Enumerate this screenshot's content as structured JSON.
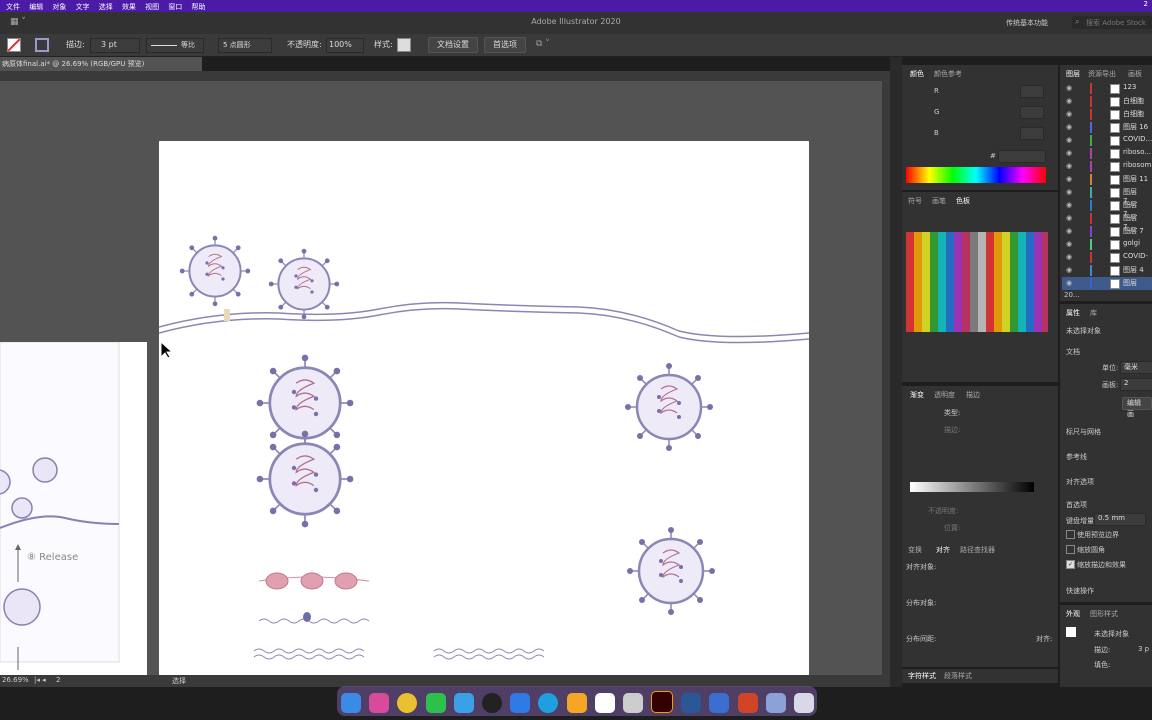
{
  "menubar": {
    "items": [
      "文件",
      "编辑",
      "对象",
      "文字",
      "选择",
      "效果",
      "视图",
      "窗口",
      "帮助"
    ],
    "right": "2"
  },
  "titlebar": {
    "title": "Adobe Illustrator 2020",
    "workspace": "传统基本功能",
    "search_placeholder": "搜索 Adobe Stock"
  },
  "options": {
    "stroke_label": "描边:",
    "stroke_value": "3 pt",
    "line_label": "等比",
    "brush_label": "5 点圆形",
    "opacity_label": "不透明度:",
    "opacity_value": "100%",
    "style_label": "样式:",
    "doc_setup": "文档设置",
    "prefs": "首选项"
  },
  "document": {
    "tab_title": "病原体final.ai* @ 26.69% (RGB/GPU 预览)"
  },
  "status": {
    "zoom": "26.69%",
    "page": "2",
    "tool": "选择"
  },
  "artboard2": {
    "release_label": "⑧ Release"
  },
  "color_panel": {
    "tabs": [
      "颜色",
      "颜色参考"
    ],
    "channels": [
      "R",
      "G",
      "B"
    ],
    "hex_label": "#"
  },
  "swatches_panel": {
    "tabs": [
      "符号",
      "画笔",
      "色板"
    ]
  },
  "gradient_panel": {
    "tabs": [
      "渐变",
      "透明度",
      "描边"
    ],
    "type_label": "类型:",
    "stroke_label": "描边:",
    "opacity_label": "不透明度:",
    "position_label": "位置:"
  },
  "align_panel": {
    "tabs": [
      "变换",
      "对齐",
      "路径查找器"
    ],
    "align_objects": "对齐对象:",
    "distribute_objects": "分布对象:",
    "distribute_spacing": "分布间距:",
    "align_to": "对齐:"
  },
  "char_panel": {
    "tabs": [
      "字符样式",
      "段落样式"
    ]
  },
  "layers_panel": {
    "tabs": [
      "图层",
      "资源导出",
      "画板"
    ],
    "count": "20...",
    "layers": [
      {
        "name": "123",
        "color": "#cc3333"
      },
      {
        "name": "白细胞",
        "color": "#cc3333"
      },
      {
        "name": "白细胞",
        "color": "#cc3333"
      },
      {
        "name": "图层 16",
        "color": "#5566dd"
      },
      {
        "name": "COVID...",
        "color": "#44aa44"
      },
      {
        "name": "riboso...",
        "color": "#aa44aa"
      },
      {
        "name": "ribosom",
        "color": "#aa44aa"
      },
      {
        "name": "图层 11",
        "color": "#cc8833"
      },
      {
        "name": "图层 7_...",
        "color": "#44aaaa"
      },
      {
        "name": "图层 7_...",
        "color": "#3377cc"
      },
      {
        "name": "图层 7_...",
        "color": "#cc3333"
      },
      {
        "name": "图层 7",
        "color": "#8844cc"
      },
      {
        "name": "golgi",
        "color": "#44cc88"
      },
      {
        "name": "COVID-",
        "color": "#cc3333"
      },
      {
        "name": "图层 4",
        "color": "#4488cc"
      },
      {
        "name": "图层",
        "color": "#3366cc"
      }
    ]
  },
  "properties_panel": {
    "tabs": [
      "属性",
      "库"
    ],
    "no_selection": "未选择对象",
    "document_label": "文档",
    "units_label": "单位:",
    "units_value": "毫米",
    "artboard_label": "画板:",
    "artboard_value": "2",
    "edit_artboards": "编辑画",
    "rulers_label": "标尺与网格",
    "guides_label": "参考线",
    "align_label": "对齐选项",
    "prefs_label": "首选项",
    "keyboard_label": "键盘增量:",
    "keyboard_value": "0.5 mm",
    "preview_bounds": "使用预览边界",
    "scale_corners": "缩放圆角",
    "scale_strokes": "缩放描边和效果",
    "quick_actions": "快速操作"
  },
  "appearance_panel": {
    "tabs": [
      "外观",
      "图形样式"
    ],
    "no_selection": "未选择对象",
    "stroke_label": "描边:",
    "stroke_value": "3 p",
    "fill_label": "填色:"
  }
}
